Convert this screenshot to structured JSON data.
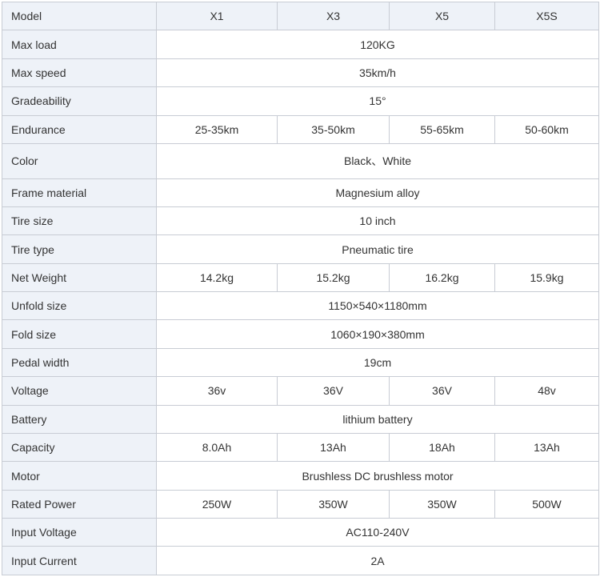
{
  "header": {
    "label": "Model",
    "models": [
      "X1",
      "X3",
      "X5",
      "X5S"
    ]
  },
  "rows": [
    {
      "label": "Max load",
      "values": [
        "120KG"
      ]
    },
    {
      "label": "Max speed",
      "values": [
        "35km/h"
      ]
    },
    {
      "label": "Gradeability",
      "values": [
        "15°"
      ]
    },
    {
      "label": "Endurance",
      "values": [
        "25-35km",
        "35-50km",
        "55-65km",
        "50-60km"
      ]
    },
    {
      "label": "Color",
      "values": [
        "Black、White"
      ]
    },
    {
      "label": "Frame material",
      "values": [
        "Magnesium alloy"
      ]
    },
    {
      "label": "Tire size",
      "values": [
        "10 inch"
      ]
    },
    {
      "label": "Tire type",
      "values": [
        "Pneumatic tire"
      ]
    },
    {
      "label": "Net Weight",
      "values": [
        "14.2kg",
        "15.2kg",
        "16.2kg",
        "15.9kg"
      ]
    },
    {
      "label": "Unfold size",
      "values": [
        "1150×540×1180mm"
      ]
    },
    {
      "label": "Fold size",
      "values": [
        "1060×190×380mm"
      ]
    },
    {
      "label": "Pedal width",
      "values": [
        "19cm"
      ]
    },
    {
      "label": "Voltage",
      "values": [
        "36v",
        "36V",
        "36V",
        "48v"
      ]
    },
    {
      "label": "Battery",
      "values": [
        "lithium battery"
      ]
    },
    {
      "label": "Capacity",
      "values": [
        "8.0Ah",
        "13Ah",
        "18Ah",
        "13Ah"
      ]
    },
    {
      "label": "Motor",
      "values": [
        "Brushless DC brushless motor"
      ]
    },
    {
      "label": "Rated Power",
      "values": [
        "250W",
        "350W",
        "350W",
        "500W"
      ]
    },
    {
      "label": "Input Voltage",
      "values": [
        "AC110-240V"
      ]
    },
    {
      "label": "Input Current",
      "values": [
        "2A"
      ]
    }
  ]
}
